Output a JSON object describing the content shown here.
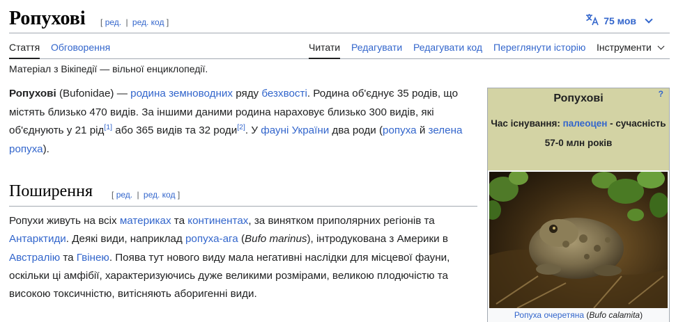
{
  "header": {
    "title": "Ропухові",
    "edit_label": "ред.",
    "edit_code_label": "ред. код",
    "sep": "|",
    "bracket_open": "[",
    "bracket_close": "]",
    "languages_label": "75 мов"
  },
  "tabs": {
    "article": "Стаття",
    "talk": "Обговорення",
    "read": "Читати",
    "edit": "Редагувати",
    "edit_code": "Редагувати код",
    "history": "Переглянути історію",
    "tools": "Інструменти"
  },
  "tagline": "Матеріал з Вікіпедії — вільної енциклопедії.",
  "intro": {
    "bold_title": "Ропухові",
    "t1": " (Bufonidae) — ",
    "l1": "родина",
    "t2": " ",
    "l2": "земноводних",
    "t3": " ряду ",
    "l3": "безхвості",
    "t4": ". Родина об'єднує 35 родів, що містять близько 470 видів. За іншими даними родина нараховує близько 300 видів, які об'єднують у 21 рід",
    "ref1": "[1]",
    "t5": " або 365 видів та 32 роди",
    "ref2": "[2]",
    "t6": ". У ",
    "l4": "фауні",
    "t7": " ",
    "l5": "України",
    "t8": " два роди (",
    "l6": "ропуха",
    "t9": " й ",
    "l7": "зелена ропуха",
    "t10": ")."
  },
  "section": {
    "heading": "Поширення",
    "t1": "Ропухи живуть на всіх ",
    "l1": "материках",
    "t2": " та ",
    "l2": "континентах",
    "t3": ", за винятком приполярних регіонів та ",
    "l3": "Антарктиди",
    "t4": ". Деякі види, наприклад ",
    "l4": "ропуха-ага",
    "t5": " (",
    "i1": "Bufo marinus",
    "t6": "), інтродукована з Америки в ",
    "l5": "Австралію",
    "t7": " та ",
    "l6": "Гвінею",
    "t8": ". Поява тут нового виду мала негативні наслідки для місцевої фауни, оскільки ці амфібії, характеризуючись дуже великими розмірами, великою плодючістю та високою токсичністю, витісняють аборигенні види."
  },
  "infobox": {
    "help": "?",
    "title": "Ропухові",
    "time_label": "Час існування: ",
    "time_link": "палеоцен",
    "time_rest": " - сучасність",
    "time_range": "57-0 млн років",
    "caption_link": "Ропуха очеретяна",
    "caption_open": " (",
    "caption_italic": "Bufo calamita",
    "caption_close": ")"
  },
  "colors": {
    "link": "#3366cc",
    "infobox_header": "#d3d3a4",
    "border": "#a2a9b1"
  },
  "icons": {
    "language": "translate-icon",
    "dropdown": "chevron-down-icon"
  }
}
